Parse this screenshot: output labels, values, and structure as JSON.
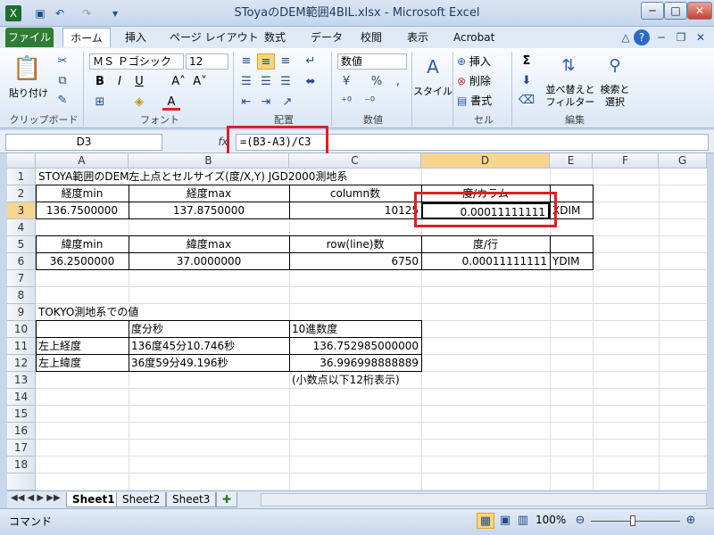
{
  "window": {
    "title": "SToyaのDEM範囲4BIL.xlsx - Microsoft Excel"
  },
  "tabs": {
    "file": "ファイル",
    "home": "ホーム",
    "insert": "挿入",
    "page_layout": "ページ レイアウト",
    "formulas": "数式",
    "data": "データ",
    "review": "校閲",
    "view": "表示",
    "acrobat": "Acrobat"
  },
  "ribbon": {
    "paste_label": "貼り付け",
    "clipboard": "クリップボード",
    "font_name": "ＭＳ Ｐゴシック",
    "font_size": "12",
    "font": "フォント",
    "alignment": "配置",
    "number_format": "数値",
    "number": "数値",
    "style_label": "スタイル",
    "insert_label": "挿入",
    "delete_label": "削除",
    "format_label": "書式",
    "cells": "セル",
    "sort_label": "並べ替えと",
    "filter_label": "フィルター",
    "find_label": "検索と",
    "select_label": "選択",
    "editing": "編集"
  },
  "formula_bar": {
    "name_box": "D3",
    "fx": "fx",
    "formula": "=(B3-A3)/C3"
  },
  "columns": [
    "A",
    "B",
    "C",
    "D",
    "E",
    "F",
    "G"
  ],
  "rows": [
    "1",
    "2",
    "3",
    "4",
    "5",
    "6",
    "7",
    "8",
    "9",
    "10",
    "11",
    "12",
    "13",
    "14",
    "15",
    "16",
    "17",
    "18"
  ],
  "cells": {
    "r1": "STOYA範囲のDEM左上点とセルサイズ(度/X,Y)  JGD2000測地系",
    "r2a": "経度min",
    "r2b": "経度max",
    "r2c": "column数",
    "r2d": "度/カラム",
    "r3a": "136.7500000",
    "r3b": "137.8750000",
    "r3c": "10125",
    "r3d": "0.00011111111",
    "r3e": "XDIM",
    "r5a": "緯度min",
    "r5b": "緯度max",
    "r5c": "row(line)数",
    "r5d": "度/行",
    "r6a": "36.2500000",
    "r6b": "37.0000000",
    "r6c": "6750",
    "r6d": "0.00011111111",
    "r6e": "YDIM",
    "r9": "TOKYO測地系での値",
    "r10b": "度分秒",
    "r10c": "10進数度",
    "r11a": "左上経度",
    "r11b": "136度45分10.746秒",
    "r11c": "136.752985000000",
    "r12a": "左上緯度",
    "r12b": "36度59分49.196秒",
    "r12c": "36.996998888889",
    "r13c": "(小数点以下12桁表示)"
  },
  "sheets": [
    "Sheet1",
    "Sheet2",
    "Sheet3"
  ],
  "status": {
    "mode": "コマンド",
    "zoom": "100%"
  }
}
